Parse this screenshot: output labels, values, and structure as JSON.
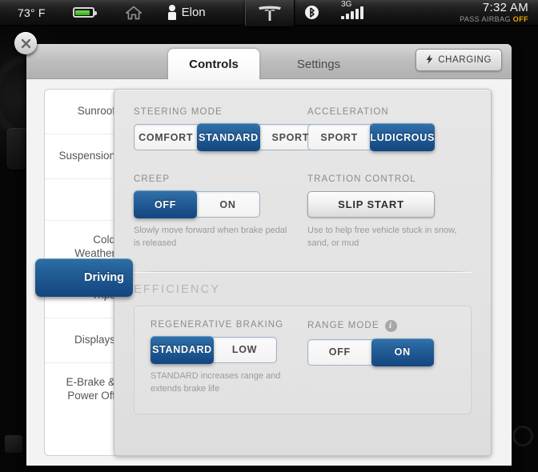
{
  "statusbar": {
    "temperature": "73° F",
    "battery_icon": "battery-icon",
    "home_icon": "home-icon",
    "driver_icon": "driver-profile-icon",
    "driver_name": "Elon",
    "logo": "tesla-logo",
    "bluetooth_icon": "bluetooth-icon",
    "network_type": "3G",
    "signal_icon": "cellular-signal-icon",
    "clock": "7:32 AM",
    "airbag_label": "PASS AIRBAG",
    "airbag_state": "OFF"
  },
  "window": {
    "close_icon": "close-icon",
    "tabs": [
      {
        "label": "Controls",
        "active": true
      },
      {
        "label": "Settings",
        "active": false
      }
    ],
    "charging_button": {
      "label": "CHARGING",
      "icon": "lightning-bolt-icon"
    }
  },
  "sidebar": {
    "items": [
      {
        "label": "Sunroof",
        "active": false
      },
      {
        "label": "Suspension",
        "active": false
      },
      {
        "label": "Driving",
        "active": true
      },
      {
        "label": "Cold\nWeather",
        "active": false
      },
      {
        "label": "Trips",
        "active": false
      },
      {
        "label": "Displays",
        "active": false
      },
      {
        "label": "E-Brake &\nPower Off",
        "active": false
      }
    ]
  },
  "controls": {
    "steering_mode": {
      "label": "STEERING MODE",
      "options": [
        "COMFORT",
        "STANDARD",
        "SPORT"
      ],
      "selected": "STANDARD"
    },
    "acceleration": {
      "label": "ACCELERATION",
      "options": [
        "SPORT",
        "LUDICROUS"
      ],
      "selected": "LUDICROUS"
    },
    "creep": {
      "label": "CREEP",
      "options": [
        "OFF",
        "ON"
      ],
      "selected": "OFF",
      "help": "Slowly move forward when brake pedal is released"
    },
    "traction_control": {
      "label": "TRACTION CONTROL",
      "button_label": "SLIP START",
      "help": "Use to help free vehicle stuck in snow, sand, or mud"
    },
    "efficiency": {
      "title": "EFFICIENCY",
      "regenerative_braking": {
        "label": "REGENERATIVE BRAKING",
        "options": [
          "STANDARD",
          "LOW"
        ],
        "selected": "STANDARD",
        "help": "STANDARD increases range and extends brake life"
      },
      "range_mode": {
        "label": "RANGE MODE",
        "info_icon": "info-icon",
        "options": [
          "OFF",
          "ON"
        ],
        "selected": "ON"
      }
    }
  },
  "colors": {
    "accent_blue": "#24619a",
    "accent_blue_dark": "#144680",
    "battery_green": "#2fab18",
    "airbag_amber": "#f0a500"
  }
}
